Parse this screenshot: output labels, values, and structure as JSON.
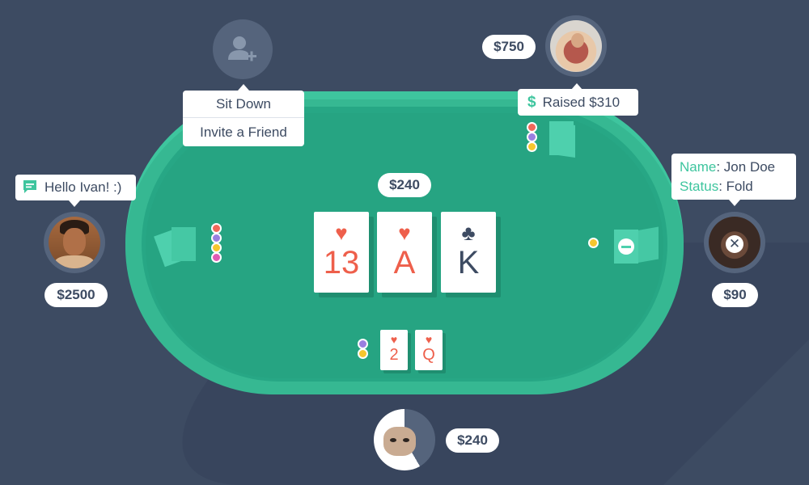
{
  "seat_top_left": {
    "menu": [
      "Sit Down",
      "Invite a Friend"
    ]
  },
  "seat_top_right": {
    "stack": "$750",
    "action": "Raised $310"
  },
  "seat_left": {
    "message": "Hello Ivan! :)",
    "stack": "$2500"
  },
  "seat_right": {
    "info_name_label": "Name",
    "info_name_value": ": Jon Doe",
    "info_status_label": "Status",
    "info_status_value": ": Fold",
    "stack": "$90"
  },
  "seat_bottom": {
    "stack": "$240",
    "hand": [
      {
        "suit": "♥",
        "rank": "2"
      },
      {
        "suit": "♥",
        "rank": "Q"
      }
    ]
  },
  "pot": "$240",
  "community_cards": [
    {
      "suit": "♥",
      "rank": "13",
      "color": "#ee5f4b"
    },
    {
      "suit": "♥",
      "rank": "A",
      "color": "#ee5f4b"
    },
    {
      "suit": "♣",
      "rank": "K",
      "color": "#3d4b62"
    }
  ],
  "colors": {
    "background": "#3d4b62",
    "table": "#3ec59e",
    "felt": "#26a482",
    "accent": "#3ec59e",
    "red_suit": "#ee5f4b",
    "chip_red": "#f0685a",
    "chip_purple": "#9a7fe0",
    "chip_yellow": "#f6c62e",
    "chip_pink": "#e05ab4"
  },
  "icons": [
    "add-user-icon",
    "dollar-icon",
    "chat-bubble-icon",
    "close-icon",
    "minus-icon"
  ]
}
